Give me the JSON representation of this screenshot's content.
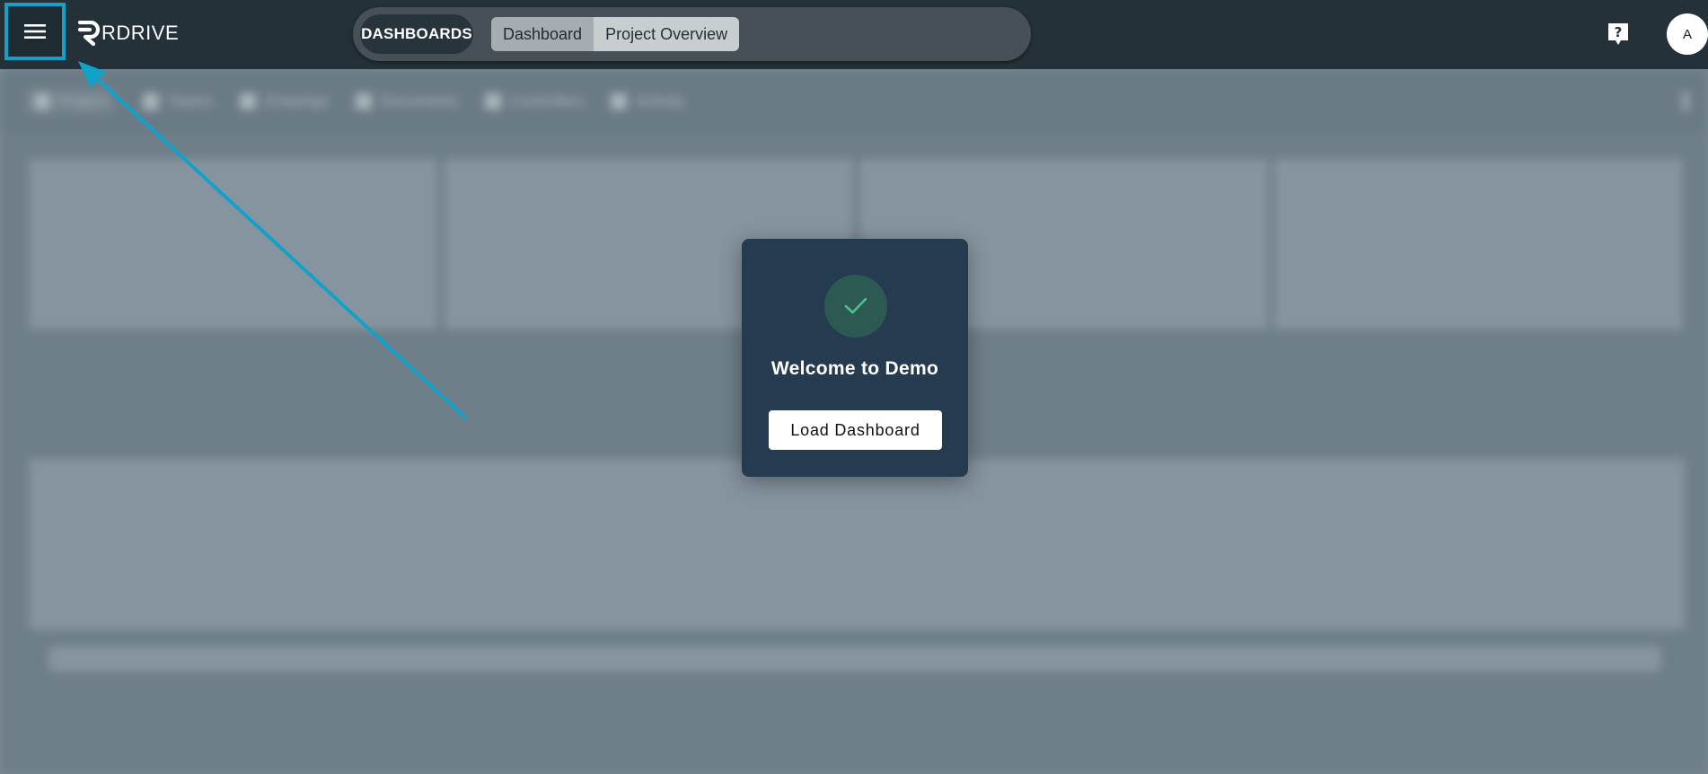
{
  "header": {
    "menu_icon": "hamburger-menu-icon",
    "logo_text": "RDRIVE",
    "dashboards_label": "DASHBOARDS",
    "tabs": [
      {
        "label": "Dashboard"
      },
      {
        "label": "Project Overview"
      }
    ],
    "help_icon": "help-question-icon",
    "avatar_initial": "A"
  },
  "background": {
    "subnav_items": [
      {
        "label": "Project"
      },
      {
        "label": "Teams"
      },
      {
        "label": "Drawings"
      },
      {
        "label": "Documents"
      },
      {
        "label": "Controllers"
      },
      {
        "label": "Activity"
      }
    ]
  },
  "modal": {
    "icon": "checkmark-icon",
    "title": "Welcome to Demo",
    "button_label": "Load Dashboard"
  },
  "colors": {
    "topbar": "#243139",
    "highlight": "#12a2c9",
    "modal_bg": "#253b50",
    "check_green": "#4fc08a"
  }
}
